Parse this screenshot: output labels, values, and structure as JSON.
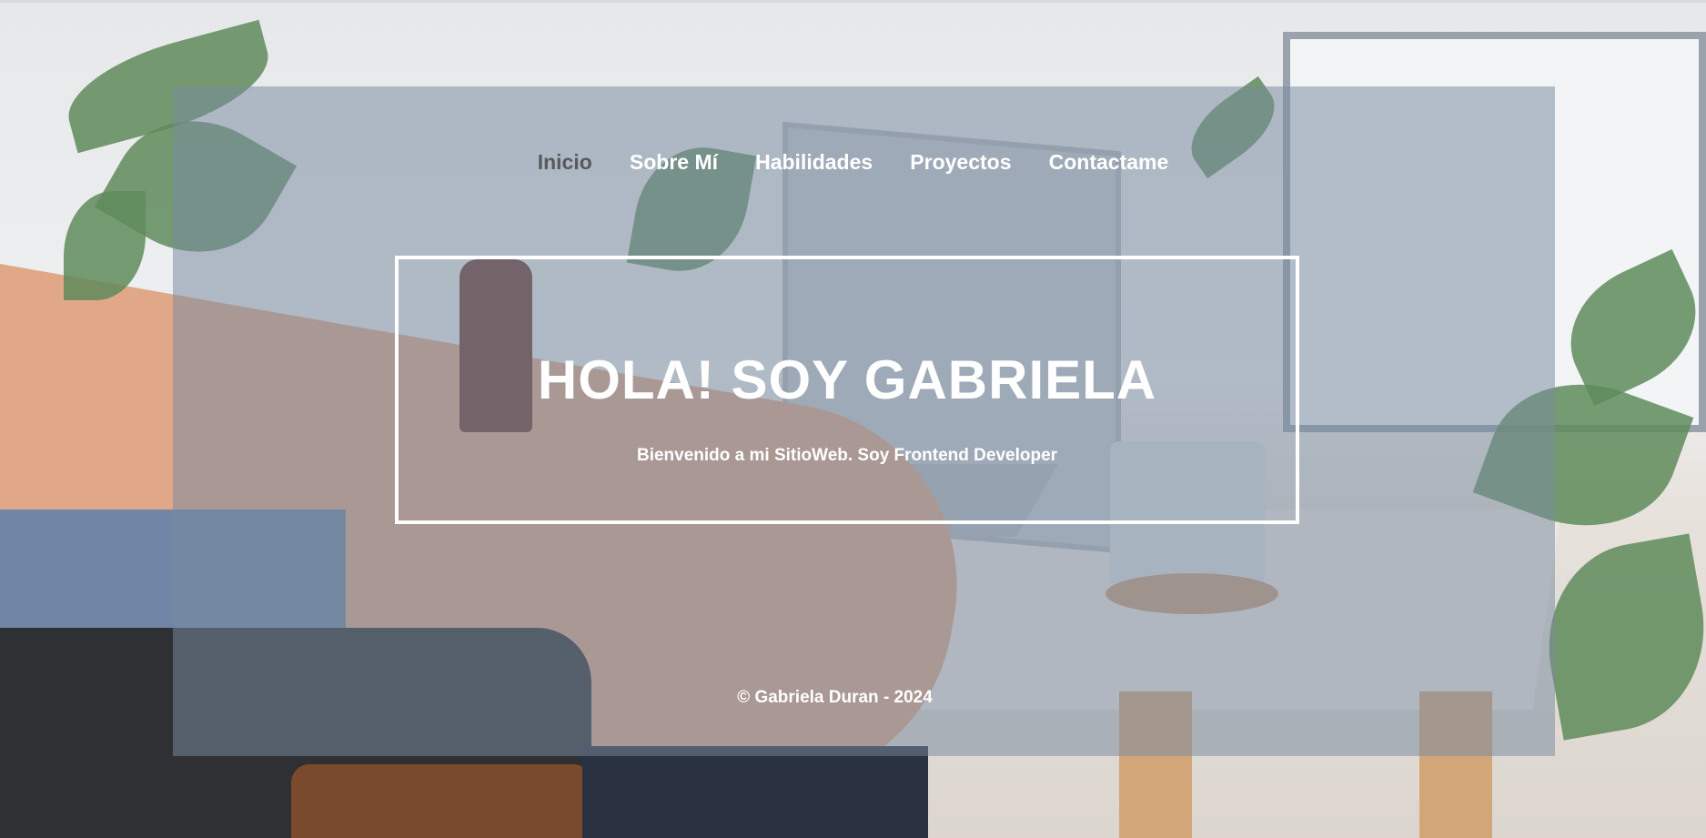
{
  "nav": {
    "items": [
      {
        "label": "Inicio",
        "active": true
      },
      {
        "label": "Sobre Mí",
        "active": false
      },
      {
        "label": "Habilidades",
        "active": false
      },
      {
        "label": "Proyectos",
        "active": false
      },
      {
        "label": "Contactame",
        "active": false
      }
    ]
  },
  "hero": {
    "title": "HOLA! SOY GABRIELA",
    "subtitle": "Bienvenido a mi SitioWeb. Soy Frontend Developer"
  },
  "footer": {
    "text": "© Gabriela Duran - 2024"
  },
  "colors": {
    "overlay": "#788aa0",
    "active_nav": "#59595b",
    "text": "#ffffff"
  }
}
